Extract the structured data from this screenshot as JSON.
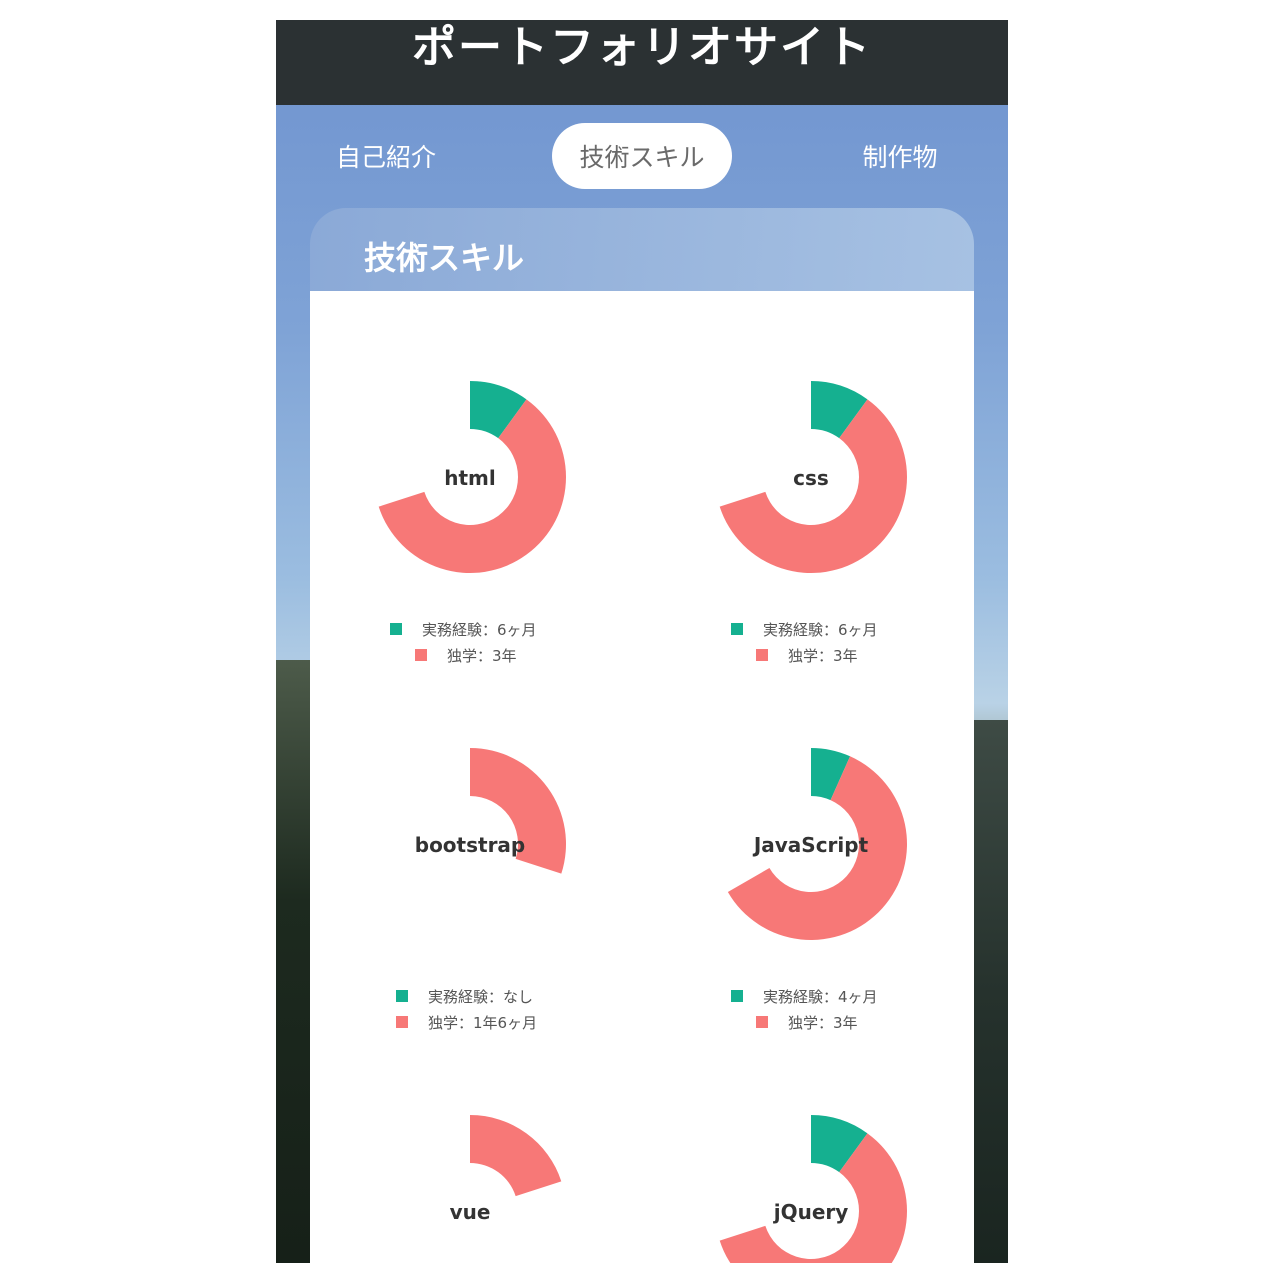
{
  "header": {
    "title": "ポートフォリオサイト"
  },
  "nav": {
    "items": [
      {
        "label": "自己紹介",
        "active": false
      },
      {
        "label": "技術スキル",
        "active": true
      },
      {
        "label": "制作物",
        "active": false
      }
    ]
  },
  "section": {
    "title": "技術スキル"
  },
  "colors": {
    "practical": "#15b090",
    "selfstudy": "#f77877"
  },
  "skills": [
    {
      "name": "html",
      "practical_label": "実務経験：6ヶ月",
      "selfstudy_label": "独学：3年",
      "practical_months": 6,
      "selfstudy_months": 36
    },
    {
      "name": "css",
      "practical_label": "実務経験：6ヶ月",
      "selfstudy_label": "独学：3年",
      "practical_months": 6,
      "selfstudy_months": 36
    },
    {
      "name": "bootstrap",
      "practical_label": "実務経験：なし",
      "selfstudy_label": "独学：1年6ヶ月",
      "practical_months": 0,
      "selfstudy_months": 18
    },
    {
      "name": "JavaScript",
      "practical_label": "実務経験：4ヶ月",
      "selfstudy_label": "独学：3年",
      "practical_months": 4,
      "selfstudy_months": 36
    },
    {
      "name": "vue",
      "practical_label": "",
      "selfstudy_label": "",
      "practical_months": 0,
      "selfstudy_months": 12
    },
    {
      "name": "jQuery",
      "practical_label": "",
      "selfstudy_label": "",
      "practical_months": 6,
      "selfstudy_months": 36
    }
  ],
  "chart_data": [
    {
      "type": "pie",
      "title": "html",
      "series": [
        {
          "name": "実務経験：6ヶ月",
          "value": 6
        },
        {
          "name": "独学：3年",
          "value": 36
        }
      ]
    },
    {
      "type": "pie",
      "title": "css",
      "series": [
        {
          "name": "実務経験：6ヶ月",
          "value": 6
        },
        {
          "name": "独学：3年",
          "value": 36
        }
      ]
    },
    {
      "type": "pie",
      "title": "bootstrap",
      "series": [
        {
          "name": "実務経験：なし",
          "value": 0
        },
        {
          "name": "独学：1年6ヶ月",
          "value": 18
        }
      ]
    },
    {
      "type": "pie",
      "title": "JavaScript",
      "series": [
        {
          "name": "実務経験：4ヶ月",
          "value": 4
        },
        {
          "name": "独学：3年",
          "value": 36
        }
      ]
    },
    {
      "type": "pie",
      "title": "vue",
      "series": [
        {
          "value": 0
        },
        {
          "value": 12
        }
      ]
    },
    {
      "type": "pie",
      "title": "jQuery",
      "series": [
        {
          "value": 6
        },
        {
          "value": 36
        }
      ]
    }
  ]
}
